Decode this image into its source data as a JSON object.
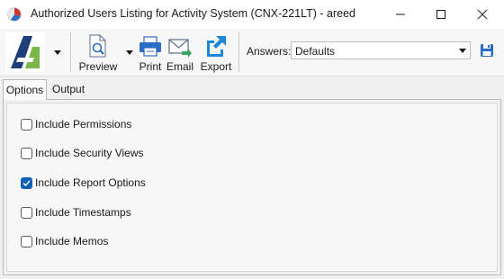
{
  "window": {
    "title": "Authorized Users Listing for Activity System (CNX-221LT) - areed"
  },
  "toolbar": {
    "preview_label": "Preview",
    "print_label": "Print",
    "email_label": "Email",
    "export_label": "Export"
  },
  "answers": {
    "label": "Answers:",
    "value": "Defaults"
  },
  "tabs": [
    {
      "label": "Options",
      "active": true
    },
    {
      "label": "Output",
      "active": false
    }
  ],
  "options": [
    {
      "label": "Include Permissions",
      "checked": false
    },
    {
      "label": "Include Security Views",
      "checked": false
    },
    {
      "label": "Include Report Options",
      "checked": true
    },
    {
      "label": "Include Timestamps",
      "checked": false
    },
    {
      "label": "Include Memos",
      "checked": false
    }
  ],
  "colors": {
    "accent": "#1160b8",
    "logo_green": "#7ab648",
    "logo_blue": "#1f3f7a"
  },
  "icons": [
    "app-icon",
    "minimize-icon",
    "maximize-icon",
    "close-icon",
    "logo-icon",
    "chevron-down-icon",
    "preview-icon",
    "printer-icon",
    "email-icon",
    "export-icon",
    "save-icon"
  ]
}
